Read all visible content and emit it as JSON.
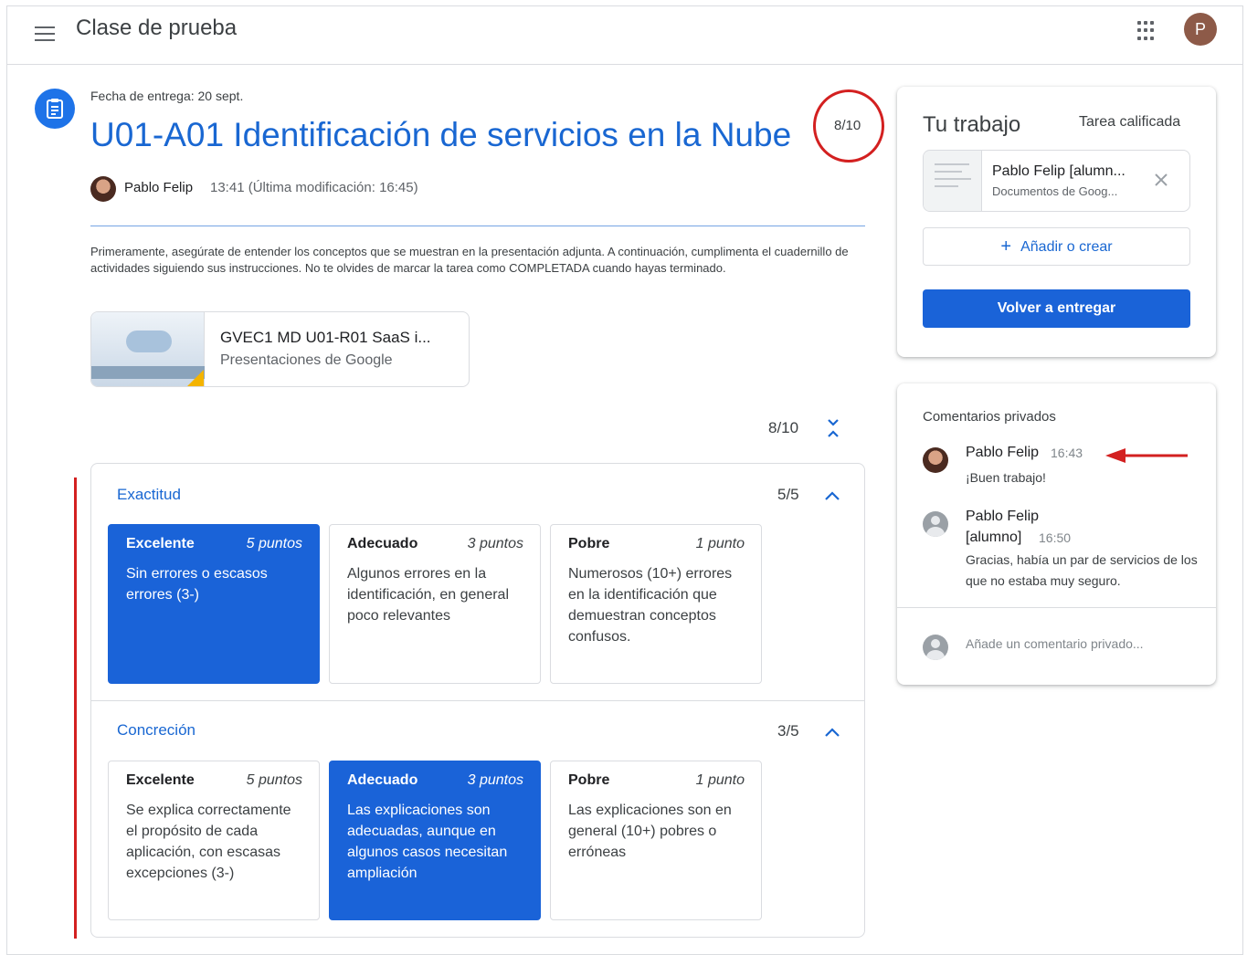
{
  "header": {
    "app_title": "Clase de prueba",
    "account_initial": "P"
  },
  "assignment": {
    "due_date": "Fecha de entrega: 20 sept.",
    "title": "U01-A01 Identificación de servicios en la Nube",
    "grade": "8/10",
    "author": "Pablo Felip",
    "time": "13:41 (Última modificación: 16:45)",
    "instructions": "Primeramente, asegúrate de entender los conceptos que se muestran en la presentación adjunta. A continuación, cumplimenta el cuadernillo de actividades siguiendo sus instrucciones. No te olvides de marcar la tarea como COMPLETADA cuando hayas terminado.",
    "attachment": {
      "name": "GVEC1 MD U01-R01 SaaS i...",
      "type": "Presentaciones de Google"
    }
  },
  "rubric": {
    "total": "8/10",
    "criteria": [
      {
        "title": "Exactitud",
        "score": "5/5",
        "levels": [
          {
            "name": "Excelente",
            "points": "5 puntos",
            "desc": "Sin errores o escasos errores (3-)",
            "selected": true
          },
          {
            "name": "Adecuado",
            "points": "3 puntos",
            "desc": "Algunos errores en la identificación, en general poco relevantes",
            "selected": false
          },
          {
            "name": "Pobre",
            "points": "1 punto",
            "desc": "Numerosos (10+) errores en la identificación que demuestran conceptos confusos.",
            "selected": false
          }
        ]
      },
      {
        "title": "Concreción",
        "score": "3/5",
        "levels": [
          {
            "name": "Excelente",
            "points": "5 puntos",
            "desc": "Se explica correctamente el propósito de cada aplicación, con escasas excepciones (3-)",
            "selected": false
          },
          {
            "name": "Adecuado",
            "points": "3 puntos",
            "desc": "Las explicaciones son adecuadas, aunque en algunos casos necesitan ampliación",
            "selected": true
          },
          {
            "name": "Pobre",
            "points": "1 punto",
            "desc": "Las explicaciones son en general (10+) pobres o erróneas",
            "selected": false
          }
        ]
      }
    ]
  },
  "your_work": {
    "title": "Tu trabajo",
    "status": "Tarea calificada",
    "file": {
      "name": "Pablo Felip [alumn...",
      "type": "Documentos de Goog..."
    },
    "add_label": "Añadir o crear",
    "add_symbol": "+",
    "resubmit_label": "Volver a entregar"
  },
  "private_comments": {
    "title": "Comentarios privados",
    "comments": [
      {
        "author": "Pablo Felip",
        "time": "16:43",
        "text": "¡Buen trabajo!"
      },
      {
        "author_line1": "Pablo Felip",
        "author_line2": "[alumno]",
        "time": "16:50",
        "text": "Gracias, había un par de servicios de los que no estaba muy seguro."
      }
    ],
    "placeholder": "Añade un comentario privado..."
  },
  "colors": {
    "accent": "#1967d2",
    "selected_level": "#1a63d8",
    "annotation_red": "#d32020"
  },
  "icons": [
    "menu-icon",
    "apps-grid-icon",
    "assignment-icon",
    "chevron-up-icon",
    "collapse-all-icon",
    "close-icon",
    "plus-icon",
    "default-avatar-icon"
  ]
}
